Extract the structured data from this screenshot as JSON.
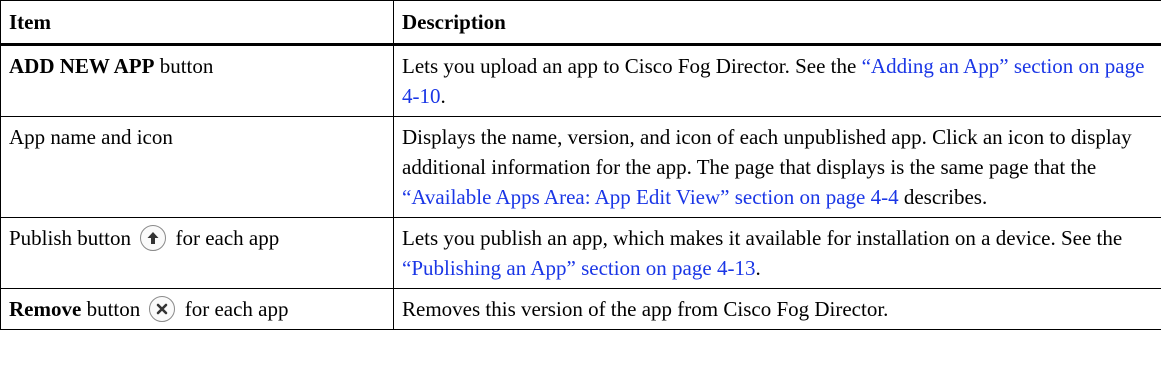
{
  "table": {
    "headers": [
      "Item",
      "Description"
    ],
    "rows": [
      {
        "item_bold": "ADD NEW APP",
        "item_rest": " button",
        "desc_before": "Lets you upload an app to Cisco Fog Director. See the ",
        "desc_link": "“Adding an App” section on page 4-10",
        "desc_after": "."
      },
      {
        "item": "App name and icon",
        "desc_before": "Displays the name, version, and icon of each unpublished app. Click an icon to display additional information for the app. The page that displays is the same page that the ",
        "desc_link": "“Available Apps Area: App Edit View” section on page 4-4",
        "desc_after": " describes."
      },
      {
        "item_before": "Publish button ",
        "icon": "up-arrow-icon",
        "item_after": " for each app",
        "desc_before": "Lets you publish an app, which makes it available for installation on a device. See the ",
        "desc_link": "“Publishing an App” section on page 4-13",
        "desc_after": "."
      },
      {
        "item_bold": "Remove",
        "item_before": " button ",
        "icon": "remove-x-icon",
        "item_after": " for each app",
        "desc": "Removes this version of the app from Cisco Fog Director."
      }
    ]
  },
  "colors": {
    "link": "#1a36e6",
    "border": "#000000"
  }
}
